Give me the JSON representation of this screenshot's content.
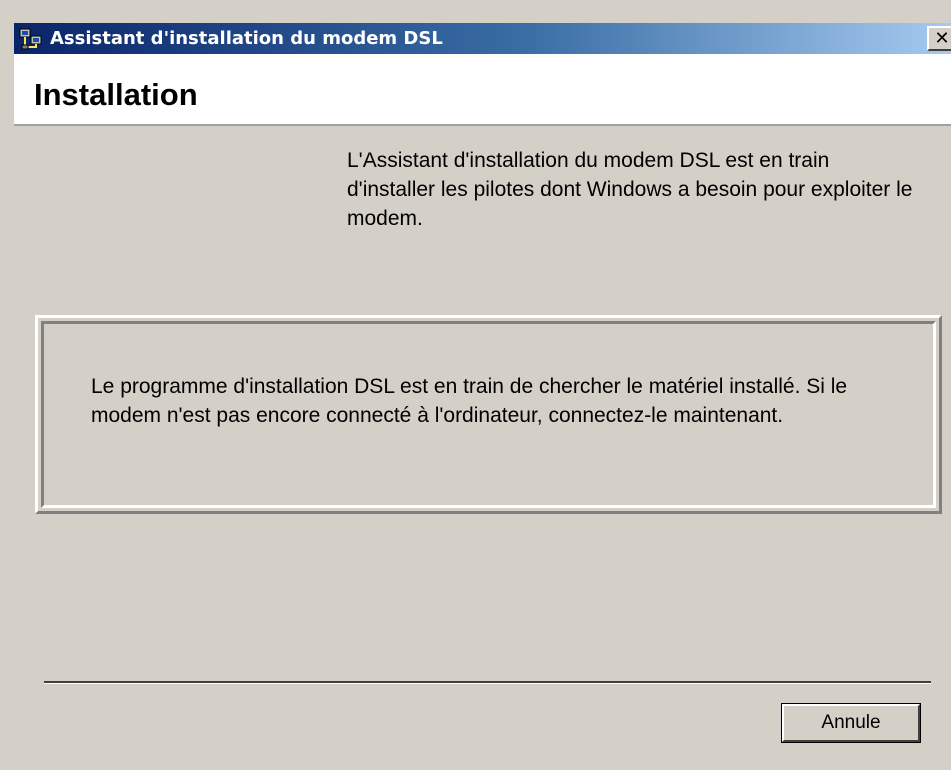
{
  "window": {
    "title": "Assistant d'installation du modem DSL",
    "close_label": "✕"
  },
  "header": {
    "title": "Installation"
  },
  "content": {
    "intro": "L'Assistant d'installation du modem DSL est en train d'installer les pilotes dont Windows a besoin pour exploiter le modem.",
    "status": "Le programme d'installation DSL est en train de chercher le matériel installé. Si le modem n'est pas encore connecté à l'ordinateur, connectez-le maintenant."
  },
  "buttons": {
    "cancel_label": "Annule"
  },
  "colors": {
    "titlebar_start": "#0a246a",
    "titlebar_end": "#a6caf0",
    "dialog_bg": "#d4d0c8"
  },
  "icons": {
    "title_icon": "network-computer-icon",
    "close_icon": "close-icon"
  }
}
